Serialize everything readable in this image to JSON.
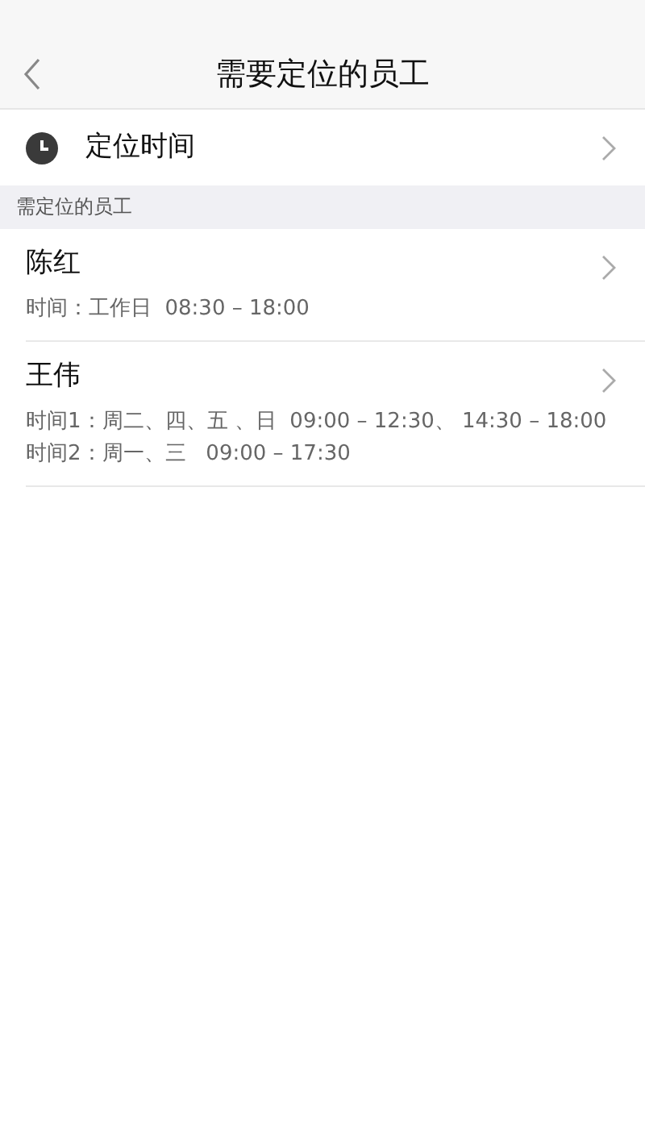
{
  "nav": {
    "title": "需要定位的员工"
  },
  "setting": {
    "label": "定位时间"
  },
  "section": {
    "title": "需定位的员工"
  },
  "employees": [
    {
      "name": "陈红",
      "times": [
        "时间：工作日  08:30 – 18:00"
      ]
    },
    {
      "name": "王伟",
      "times": [
        "时间1：周二、四、五 、日  09:00 – 12:30、 14:30 – 18:00",
        "时间2：周一、三   09:00 – 17:30"
      ]
    }
  ]
}
